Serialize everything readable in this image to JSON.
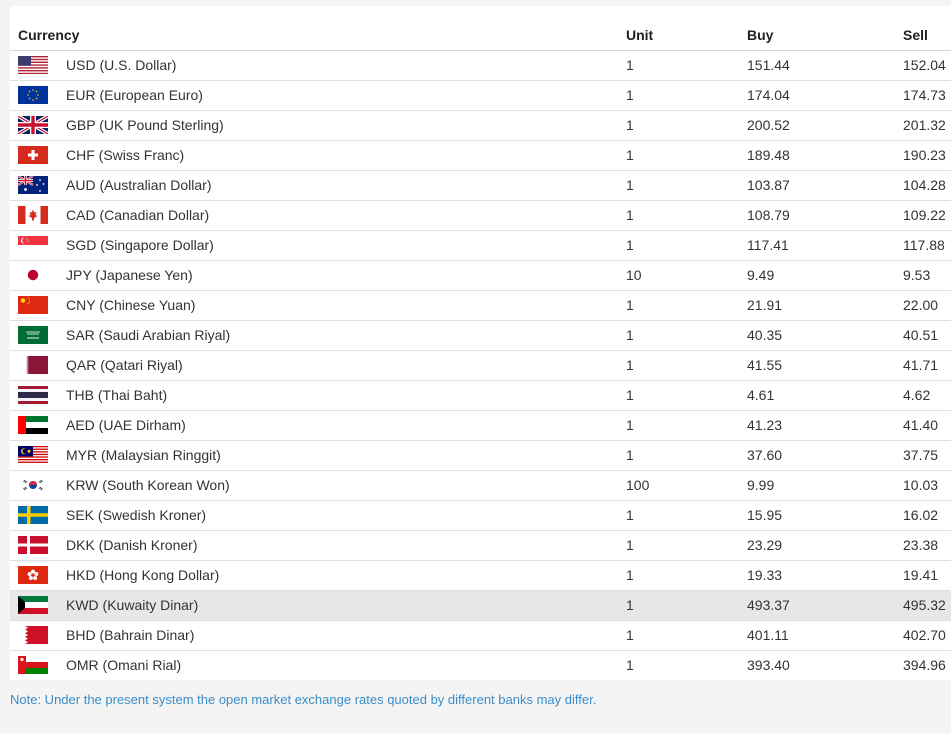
{
  "headers": {
    "currency": "Currency",
    "unit": "Unit",
    "buy": "Buy",
    "sell": "Sell"
  },
  "rows": [
    {
      "flag": "us-flag-icon",
      "currency": "USD (U.S. Dollar)",
      "unit": "1",
      "buy": "151.44",
      "sell": "152.04"
    },
    {
      "flag": "eu-flag-icon",
      "currency": "EUR (European Euro)",
      "unit": "1",
      "buy": "174.04",
      "sell": "174.73"
    },
    {
      "flag": "uk-flag-icon",
      "currency": "GBP (UK Pound Sterling)",
      "unit": "1",
      "buy": "200.52",
      "sell": "201.32"
    },
    {
      "flag": "swiss-flag-icon",
      "currency": "CHF (Swiss Franc)",
      "unit": "1",
      "buy": "189.48",
      "sell": "190.23"
    },
    {
      "flag": "australia-flag-icon",
      "currency": "AUD (Australian Dollar)",
      "unit": "1",
      "buy": "103.87",
      "sell": "104.28"
    },
    {
      "flag": "canada-flag-icon",
      "currency": "CAD (Canadian Dollar)",
      "unit": "1",
      "buy": "108.79",
      "sell": "109.22"
    },
    {
      "flag": "singapore-flag-icon",
      "currency": "SGD (Singapore Dollar)",
      "unit": "1",
      "buy": "117.41",
      "sell": "117.88"
    },
    {
      "flag": "japan-flag-icon",
      "currency": "JPY (Japanese Yen)",
      "unit": "10",
      "buy": "9.49",
      "sell": "9.53"
    },
    {
      "flag": "china-flag-icon",
      "currency": "CNY (Chinese Yuan)",
      "unit": "1",
      "buy": "21.91",
      "sell": "22.00"
    },
    {
      "flag": "saudi-flag-icon",
      "currency": "SAR (Saudi Arabian Riyal)",
      "unit": "1",
      "buy": "40.35",
      "sell": "40.51"
    },
    {
      "flag": "qatar-flag-icon",
      "currency": "QAR (Qatari Riyal)",
      "unit": "1",
      "buy": "41.55",
      "sell": "41.71"
    },
    {
      "flag": "thailand-flag-icon",
      "currency": "THB (Thai Baht)",
      "unit": "1",
      "buy": "4.61",
      "sell": "4.62"
    },
    {
      "flag": "uae-flag-icon",
      "currency": "AED (UAE Dirham)",
      "unit": "1",
      "buy": "41.23",
      "sell": "41.40"
    },
    {
      "flag": "malaysia-flag-icon",
      "currency": "MYR (Malaysian Ringgit)",
      "unit": "1",
      "buy": "37.60",
      "sell": "37.75"
    },
    {
      "flag": "korea-flag-icon",
      "currency": "KRW (South Korean Won)",
      "unit": "100",
      "buy": "9.99",
      "sell": "10.03"
    },
    {
      "flag": "sweden-flag-icon",
      "currency": "SEK (Swedish Kroner)",
      "unit": "1",
      "buy": "15.95",
      "sell": "16.02"
    },
    {
      "flag": "denmark-flag-icon",
      "currency": "DKK (Danish Kroner)",
      "unit": "1",
      "buy": "23.29",
      "sell": "23.38"
    },
    {
      "flag": "hongkong-flag-icon",
      "currency": "HKD (Hong Kong Dollar)",
      "unit": "1",
      "buy": "19.33",
      "sell": "19.41"
    },
    {
      "flag": "kuwait-flag-icon",
      "currency": "KWD (Kuwaity Dinar)",
      "unit": "1",
      "buy": "493.37",
      "sell": "495.32",
      "highlighted": true
    },
    {
      "flag": "bahrain-flag-icon",
      "currency": "BHD (Bahrain Dinar)",
      "unit": "1",
      "buy": "401.11",
      "sell": "402.70"
    },
    {
      "flag": "oman-flag-icon",
      "currency": "OMR (Omani Rial)",
      "unit": "1",
      "buy": "393.40",
      "sell": "394.96"
    }
  ],
  "note": "Note: Under the present system the open market exchange rates quoted by different banks may differ."
}
